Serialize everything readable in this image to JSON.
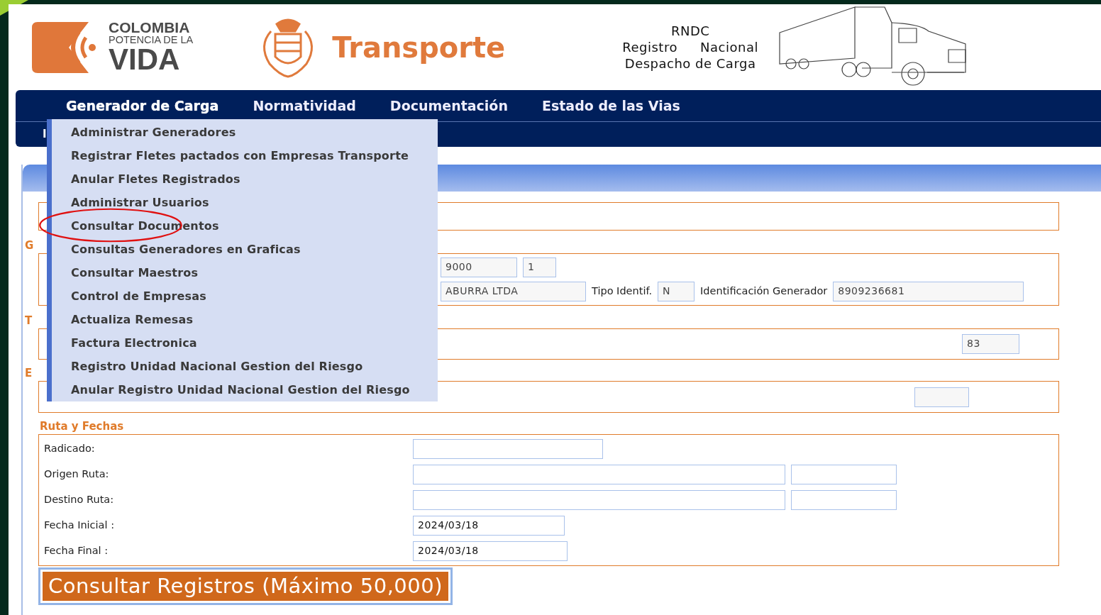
{
  "header": {
    "logo_lines": [
      "COLOMBIA",
      "POTENCIA DE LA",
      "VIDA"
    ],
    "ministry": "Transporte",
    "system": {
      "acronym": "RNDC",
      "name_lines": [
        "Registro Nacional",
        "Despacho de Carga"
      ]
    }
  },
  "nav": {
    "items": [
      {
        "label": "Generador de Carga",
        "expanded": true
      },
      {
        "label": "Normatividad",
        "expanded": false
      },
      {
        "label": "Documentación",
        "expanded": false
      },
      {
        "label": "Estado de las Vias",
        "expanded": false
      }
    ],
    "subnav_fragment": "I"
  },
  "dropdown": {
    "items": [
      {
        "label": "Administrar Generadores",
        "circled": false
      },
      {
        "label": "Registrar Fletes pactados con Empresas Transporte",
        "circled": false
      },
      {
        "label": "Anular Fletes Registrados",
        "circled": false
      },
      {
        "label": "Administrar Usuarios",
        "circled": false
      },
      {
        "label": "Consultar Documentos",
        "circled": true
      },
      {
        "label": "Consultas Generadores en Graficas",
        "circled": false
      },
      {
        "label": "Consultar Maestros",
        "circled": false
      },
      {
        "label": "Control de Empresas",
        "circled": false
      },
      {
        "label": "Actualiza Remesas",
        "circled": false
      },
      {
        "label": "Factura Electronica",
        "circled": false
      },
      {
        "label": "Registro Unidad Nacional Gestion del Riesgo",
        "circled": false
      },
      {
        "label": "Anular Registro Unidad Nacional Gestion del Riesgo",
        "circled": false
      }
    ]
  },
  "form": {
    "sections": [
      {
        "kind": "blank"
      },
      {
        "kind": "inline",
        "legend": "G",
        "rows": [
          [
            {
              "kind": "input",
              "value": "9000"
            },
            {
              "kind": "input",
              "value": "1"
            }
          ],
          [
            {
              "kind": "input",
              "value": "ABURRA LTDA"
            },
            {
              "kind": "label",
              "text": "Tipo Identif."
            },
            {
              "kind": "input",
              "value": "N"
            },
            {
              "kind": "label",
              "text": "Identificación Generador"
            },
            {
              "kind": "input",
              "value": "8909236681"
            }
          ]
        ]
      },
      {
        "kind": "right",
        "legend": "T",
        "rows": [
          [
            {
              "kind": "input",
              "value": "83"
            }
          ]
        ]
      },
      {
        "kind": "right",
        "legend": "E",
        "rows": [
          [
            {
              "kind": "input"
            }
          ]
        ]
      },
      {
        "kind": "grid",
        "legend": "Ruta y Fechas",
        "rows": [
          {
            "label": "Radicado:",
            "inputs": [
              {
                "kind": "input"
              }
            ]
          },
          {
            "label": "Origen Ruta:",
            "inputs": [
              {
                "kind": "input"
              },
              {
                "kind": "input"
              }
            ]
          },
          {
            "label": "Destino Ruta:",
            "inputs": [
              {
                "kind": "input"
              },
              {
                "kind": "input"
              }
            ]
          },
          {
            "label": "Fecha Inicial :",
            "inputs": [
              {
                "kind": "input",
                "value": "2024/03/18"
              }
            ]
          },
          {
            "label": "Fecha Final :",
            "inputs": [
              {
                "kind": "input",
                "value": "2024/03/18"
              }
            ]
          }
        ]
      }
    ],
    "submit": "Consultar Registros (Máximo 50,000)"
  }
}
